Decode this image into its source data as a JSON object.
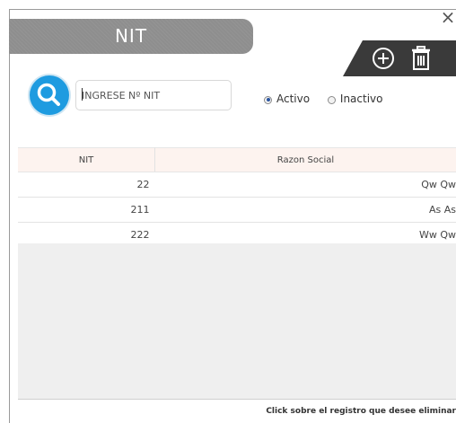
{
  "window": {
    "title": "NIT",
    "close_label": "×"
  },
  "toolbar": {
    "add": "add-icon",
    "delete": "trash-icon"
  },
  "search": {
    "placeholder": "INGRESE Nº NIT",
    "value": ""
  },
  "filters": {
    "selected": "Activo",
    "options": [
      {
        "label": "Activo",
        "checked": true
      },
      {
        "label": "Inactivo",
        "checked": false
      }
    ]
  },
  "table": {
    "columns": [
      "NIT",
      "Razon Social"
    ],
    "rows": [
      {
        "nit": "22",
        "razon": "Qw Qw"
      },
      {
        "nit": "211",
        "razon": "As As"
      },
      {
        "nit": "222",
        "razon": "Ww Qw"
      }
    ]
  },
  "footer": {
    "hint": "Click  sobre el registro que desee  eliminar"
  },
  "colors": {
    "accent": "#1e9be0",
    "header_bar": "#8e8e8e",
    "action_bar": "#3a3a3a",
    "table_header": "#fdf3ef",
    "empty_area": "#efefef"
  }
}
